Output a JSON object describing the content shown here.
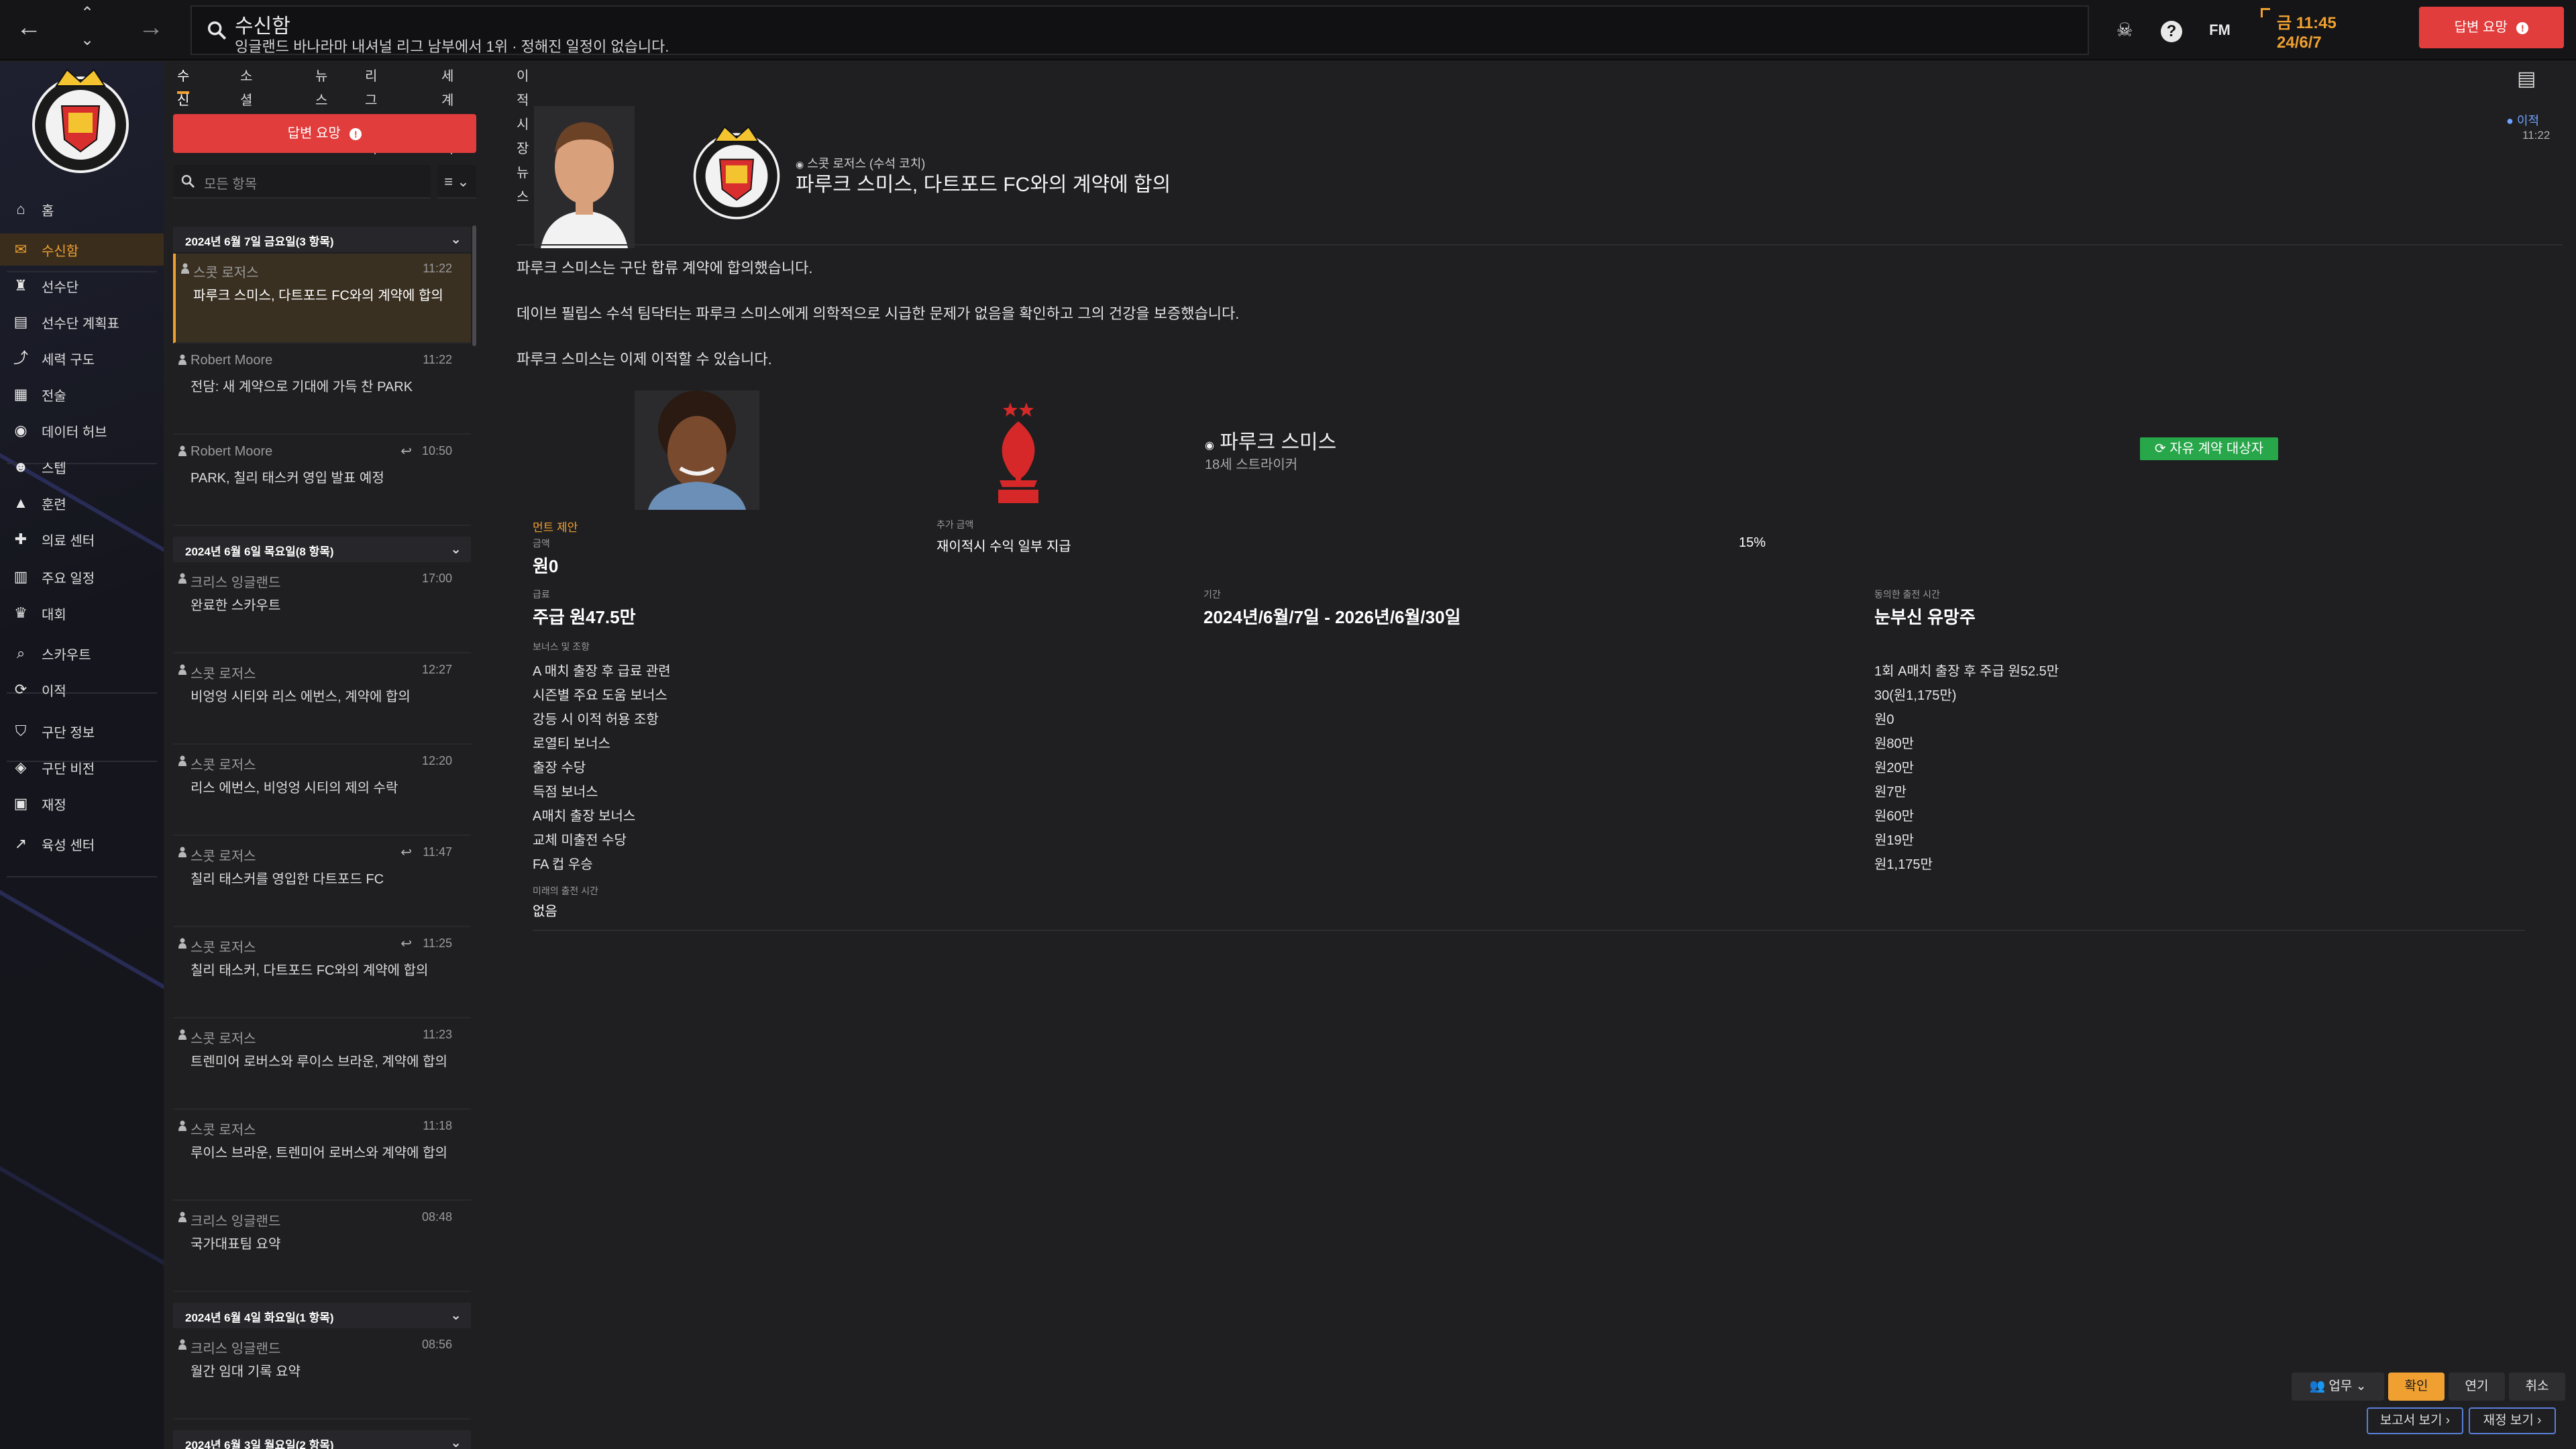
{
  "window": {
    "title": "수신함"
  },
  "search": {
    "title": "수신함",
    "subtitle": "잉글랜드 바나라마 내셔널 리그 남부에서 1위 · 정해진 일정이 없습니다."
  },
  "top_icons": {
    "fm_label": "FM"
  },
  "datetime": {
    "time": "11:45",
    "weekday": "금",
    "date": "24/6/7"
  },
  "reply_top_label": "답변 요망",
  "sidebar": {
    "items": [
      {
        "label": "홈",
        "icon": "home-icon"
      },
      {
        "label": "수신함",
        "icon": "inbox-icon",
        "active": true
      },
      {
        "label": "선수단",
        "icon": "shirt-icon"
      },
      {
        "label": "선수단 계획표",
        "icon": "clipboard-icon"
      },
      {
        "label": "세력 구도",
        "icon": "hierarchy-icon"
      },
      {
        "label": "전술",
        "icon": "tactics-icon"
      },
      {
        "label": "데이터 허브",
        "icon": "data-hub-icon"
      },
      {
        "label": "스텝",
        "icon": "staff-icon"
      },
      {
        "label": "훈련",
        "icon": "training-icon"
      },
      {
        "label": "의료 센터",
        "icon": "medical-icon"
      },
      {
        "label": "주요 일정",
        "icon": "calendar-icon"
      },
      {
        "label": "대회",
        "icon": "trophy-icon"
      },
      {
        "label": "스카우트",
        "icon": "scouting-icon"
      },
      {
        "label": "이적",
        "icon": "transfer-icon"
      },
      {
        "label": "구단 정보",
        "icon": "shield-icon"
      },
      {
        "label": "구단 비전",
        "icon": "vision-icon"
      },
      {
        "label": "재정",
        "icon": "finance-icon"
      },
      {
        "label": "육성 센터",
        "icon": "development-icon"
      }
    ]
  },
  "tabs": [
    "수신함",
    "소셜 피드",
    "뉴스",
    "리그 소식",
    "세계 소식",
    "이적 시장 뉴스"
  ],
  "inbox": {
    "reply_button": "답변 요망",
    "filter_placeholder": "모든 항목",
    "sort_label": "≡",
    "groups": [
      {
        "header": "2024년 6월 7일 금요일(3 항목)",
        "messages": [
          {
            "sender": "스콧 로저스",
            "time": "11:22",
            "subject": "파루크 스미스, 다트포드 FC와의 계약에 합의",
            "selected": true
          },
          {
            "sender": "Robert Moore",
            "time": "11:22",
            "subject": "전담: 새 계약으로 기대에 가득 찬 PARK"
          },
          {
            "sender": "Robert Moore",
            "time": "10:50",
            "subject": "PARK, 칠리 태스커 영입 발표 예정",
            "reply": true
          }
        ]
      },
      {
        "header": "2024년 6월 6일 목요일(8 항목)",
        "messages": [
          {
            "sender": "크리스 잉글랜드",
            "time": "17:00",
            "subject": "완료한 스카우트"
          },
          {
            "sender": "스콧 로저스",
            "time": "12:27",
            "subject": "비엉엉 시티와 리스 에번스, 계약에 합의"
          },
          {
            "sender": "스콧 로저스",
            "time": "12:20",
            "subject": "리스 에번스, 비엉엉 시티의 제의 수락"
          },
          {
            "sender": "스콧 로저스",
            "time": "11:47",
            "subject": "칠리 태스커를 영입한 다트포드 FC",
            "reply": true
          },
          {
            "sender": "스콧 로저스",
            "time": "11:25",
            "subject": "칠리 태스커, 다트포드 FC와의 계약에 합의",
            "reply": true
          },
          {
            "sender": "스콧 로저스",
            "time": "11:23",
            "subject": "트렌미어 로버스와 루이스 브라운, 계약에 합의"
          },
          {
            "sender": "스콧 로저스",
            "time": "11:18",
            "subject": "루이스 브라운, 트렌미어 로버스와 계약에 합의"
          },
          {
            "sender": "크리스 잉글랜드",
            "time": "08:48",
            "subject": "국가대표팀 요약"
          }
        ]
      },
      {
        "header": "2024년 6월 4일 화요일(1 항목)",
        "messages": [
          {
            "sender": "크리스 잉글랜드",
            "time": "08:56",
            "subject": "월간 임대 기록 요약"
          }
        ]
      },
      {
        "header": "2024년 6월 3일 월요일(2 항목)",
        "messages": []
      }
    ]
  },
  "detail": {
    "sender": "스콧 로저스 (수석 코치)",
    "title": "파루크 스미스, 다트포드 FC와의 계약에 합의",
    "unread_tag": "이적",
    "unread_time": "11:22",
    "paragraphs": [
      "파루크 스미스는 구단 합류 계약에 합의했습니다.",
      "데이브 필립스 수석 팀닥터는 파루크 스미스에게 의학적으로 시급한 문제가 없음을 확인하고 그의 건강을 보증했습니다.",
      "파루크 스미스는 이제 이적할 수 있습니다."
    ],
    "player": {
      "name": "파루크 스미스",
      "age_pos": "18세 스트라이커",
      "badge": "자유 계약 대상자"
    },
    "contract": {
      "offer_label": "먼트 제안",
      "fee_label": "금액",
      "fee_value": "원0",
      "extra_label": "추가 금액",
      "extra_value": "재이적시 수익 일부 지급",
      "extra_percent": "15%",
      "wage_label": "급료",
      "wage_value": "주급 원47.5만",
      "period_label": "기간",
      "period_value": "2024년/6월/7일 - 2026년/6월/30일",
      "playing_label": "동의한 출전 시간",
      "playing_value": "눈부신 유망주",
      "bonus_label": "보너스 및 조항",
      "bonuses": [
        {
          "label": "A 매치 출장 후 급료 관련",
          "value": "1회 A매치 출장 후 주급 원52.5만"
        },
        {
          "label": "시즌별 주요 도움 보너스",
          "value": "30(원1,175만)"
        },
        {
          "label": "강등 시 이적 허용 조항",
          "value": "원0"
        },
        {
          "label": "로열티 보너스",
          "value": "원80만"
        },
        {
          "label": "출장 수당",
          "value": "원20만"
        },
        {
          "label": "득점 보너스",
          "value": "원7만"
        },
        {
          "label": "A매치 출장 보너스",
          "value": "원60만"
        },
        {
          "label": "교체 미출전 수당",
          "value": "원19만"
        },
        {
          "label": "FA 컵 우승",
          "value": "원1,175만"
        }
      ],
      "future_label": "미래의 출전 시간",
      "future_value": "없음"
    }
  },
  "actions": {
    "work": "업무",
    "confirm": "확인",
    "delay": "연기",
    "cancel": "취소",
    "report": "보고서 보기",
    "finance": "재정 보기"
  },
  "colors": {
    "accent": "#f0a030",
    "danger": "#e23d3d",
    "success": "#27a64a",
    "link": "#6fa3ff"
  }
}
